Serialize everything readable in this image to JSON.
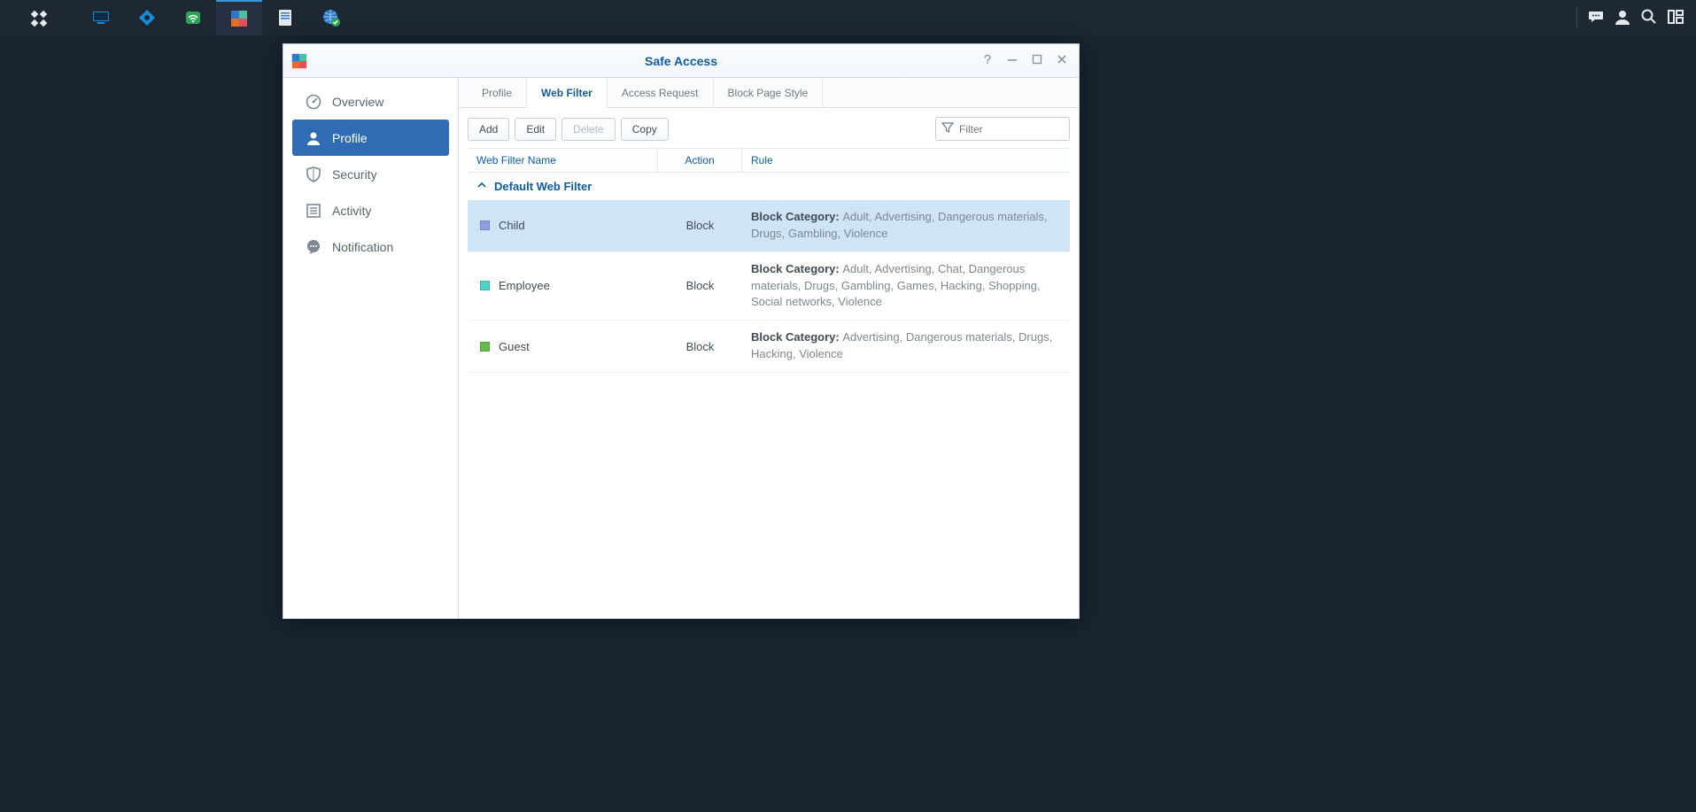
{
  "taskbar": {
    "apps": [
      "main-menu",
      "desktop",
      "network",
      "wifi",
      "safe-access",
      "notes",
      "web"
    ],
    "active_index": 4,
    "tools": [
      "chat",
      "user",
      "search",
      "widgets"
    ]
  },
  "window": {
    "title": "Safe Access"
  },
  "sidebar": {
    "items": [
      {
        "label": "Overview"
      },
      {
        "label": "Profile"
      },
      {
        "label": "Security"
      },
      {
        "label": "Activity"
      },
      {
        "label": "Notification"
      }
    ],
    "active_index": 1
  },
  "tabs": {
    "items": [
      {
        "label": "Profile"
      },
      {
        "label": "Web Filter"
      },
      {
        "label": "Access Request"
      },
      {
        "label": "Block Page Style"
      }
    ],
    "active_index": 1
  },
  "toolbar": {
    "add": "Add",
    "edit": "Edit",
    "delete": "Delete",
    "copy": "Copy",
    "filter_placeholder": "Filter"
  },
  "grid": {
    "columns": {
      "name": "Web Filter Name",
      "action": "Action",
      "rule": "Rule"
    },
    "group_label": "Default Web Filter",
    "rule_prefix": "Block Category: ",
    "rows": [
      {
        "name": "Child",
        "color": "#8f9ee3",
        "action": "Block",
        "rule": "Adult, Advertising, Dangerous materials, Drugs, Gambling, Violence",
        "selected": true
      },
      {
        "name": "Employee",
        "color": "#4fd1c5",
        "action": "Block",
        "rule": "Adult, Advertising, Chat, Dangerous materials, Drugs, Gambling, Games, Hacking, Shopping, Social networks, Violence",
        "selected": false
      },
      {
        "name": "Guest",
        "color": "#66bb4e",
        "action": "Block",
        "rule": "Advertising, Dangerous materials, Drugs, Hacking, Violence",
        "selected": false
      }
    ]
  }
}
